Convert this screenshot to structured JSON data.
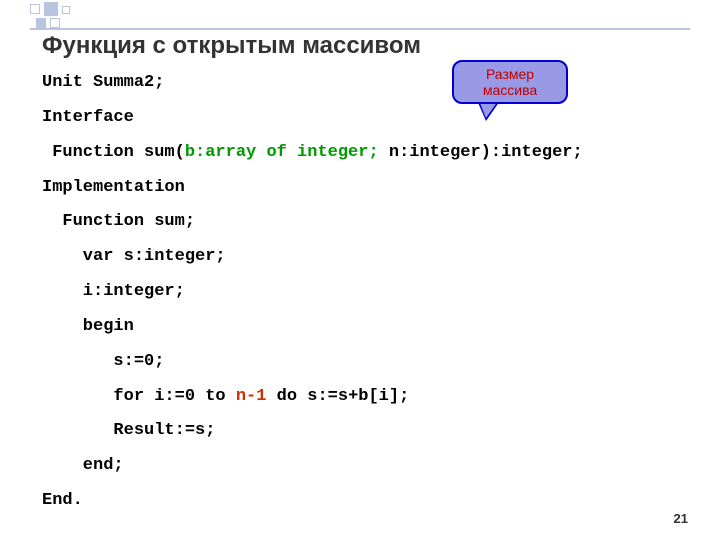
{
  "title": "Функция с открытым массивом",
  "callout": {
    "line1": "Размер",
    "line2": "массива"
  },
  "code": {
    "l1": "Unit Summa2;",
    "l2": "Interface",
    "l3a": " Function sum(",
    "l3b": "b:array of integer;",
    "l3c": " n:integer):integer;",
    "l4": "Implementation",
    "l5": "  Function sum;",
    "l6": "    var s:integer;",
    "l7": "    i:integer;",
    "l8": "    begin",
    "l9": "       s:=0;",
    "l10a": "       for i:=0 to ",
    "l10b": "n-1",
    "l10c": " do s:=s+b[i];",
    "l11": "       Result:=s;",
    "l12": "    end;",
    "l13": "End."
  },
  "pageNumber": "21"
}
